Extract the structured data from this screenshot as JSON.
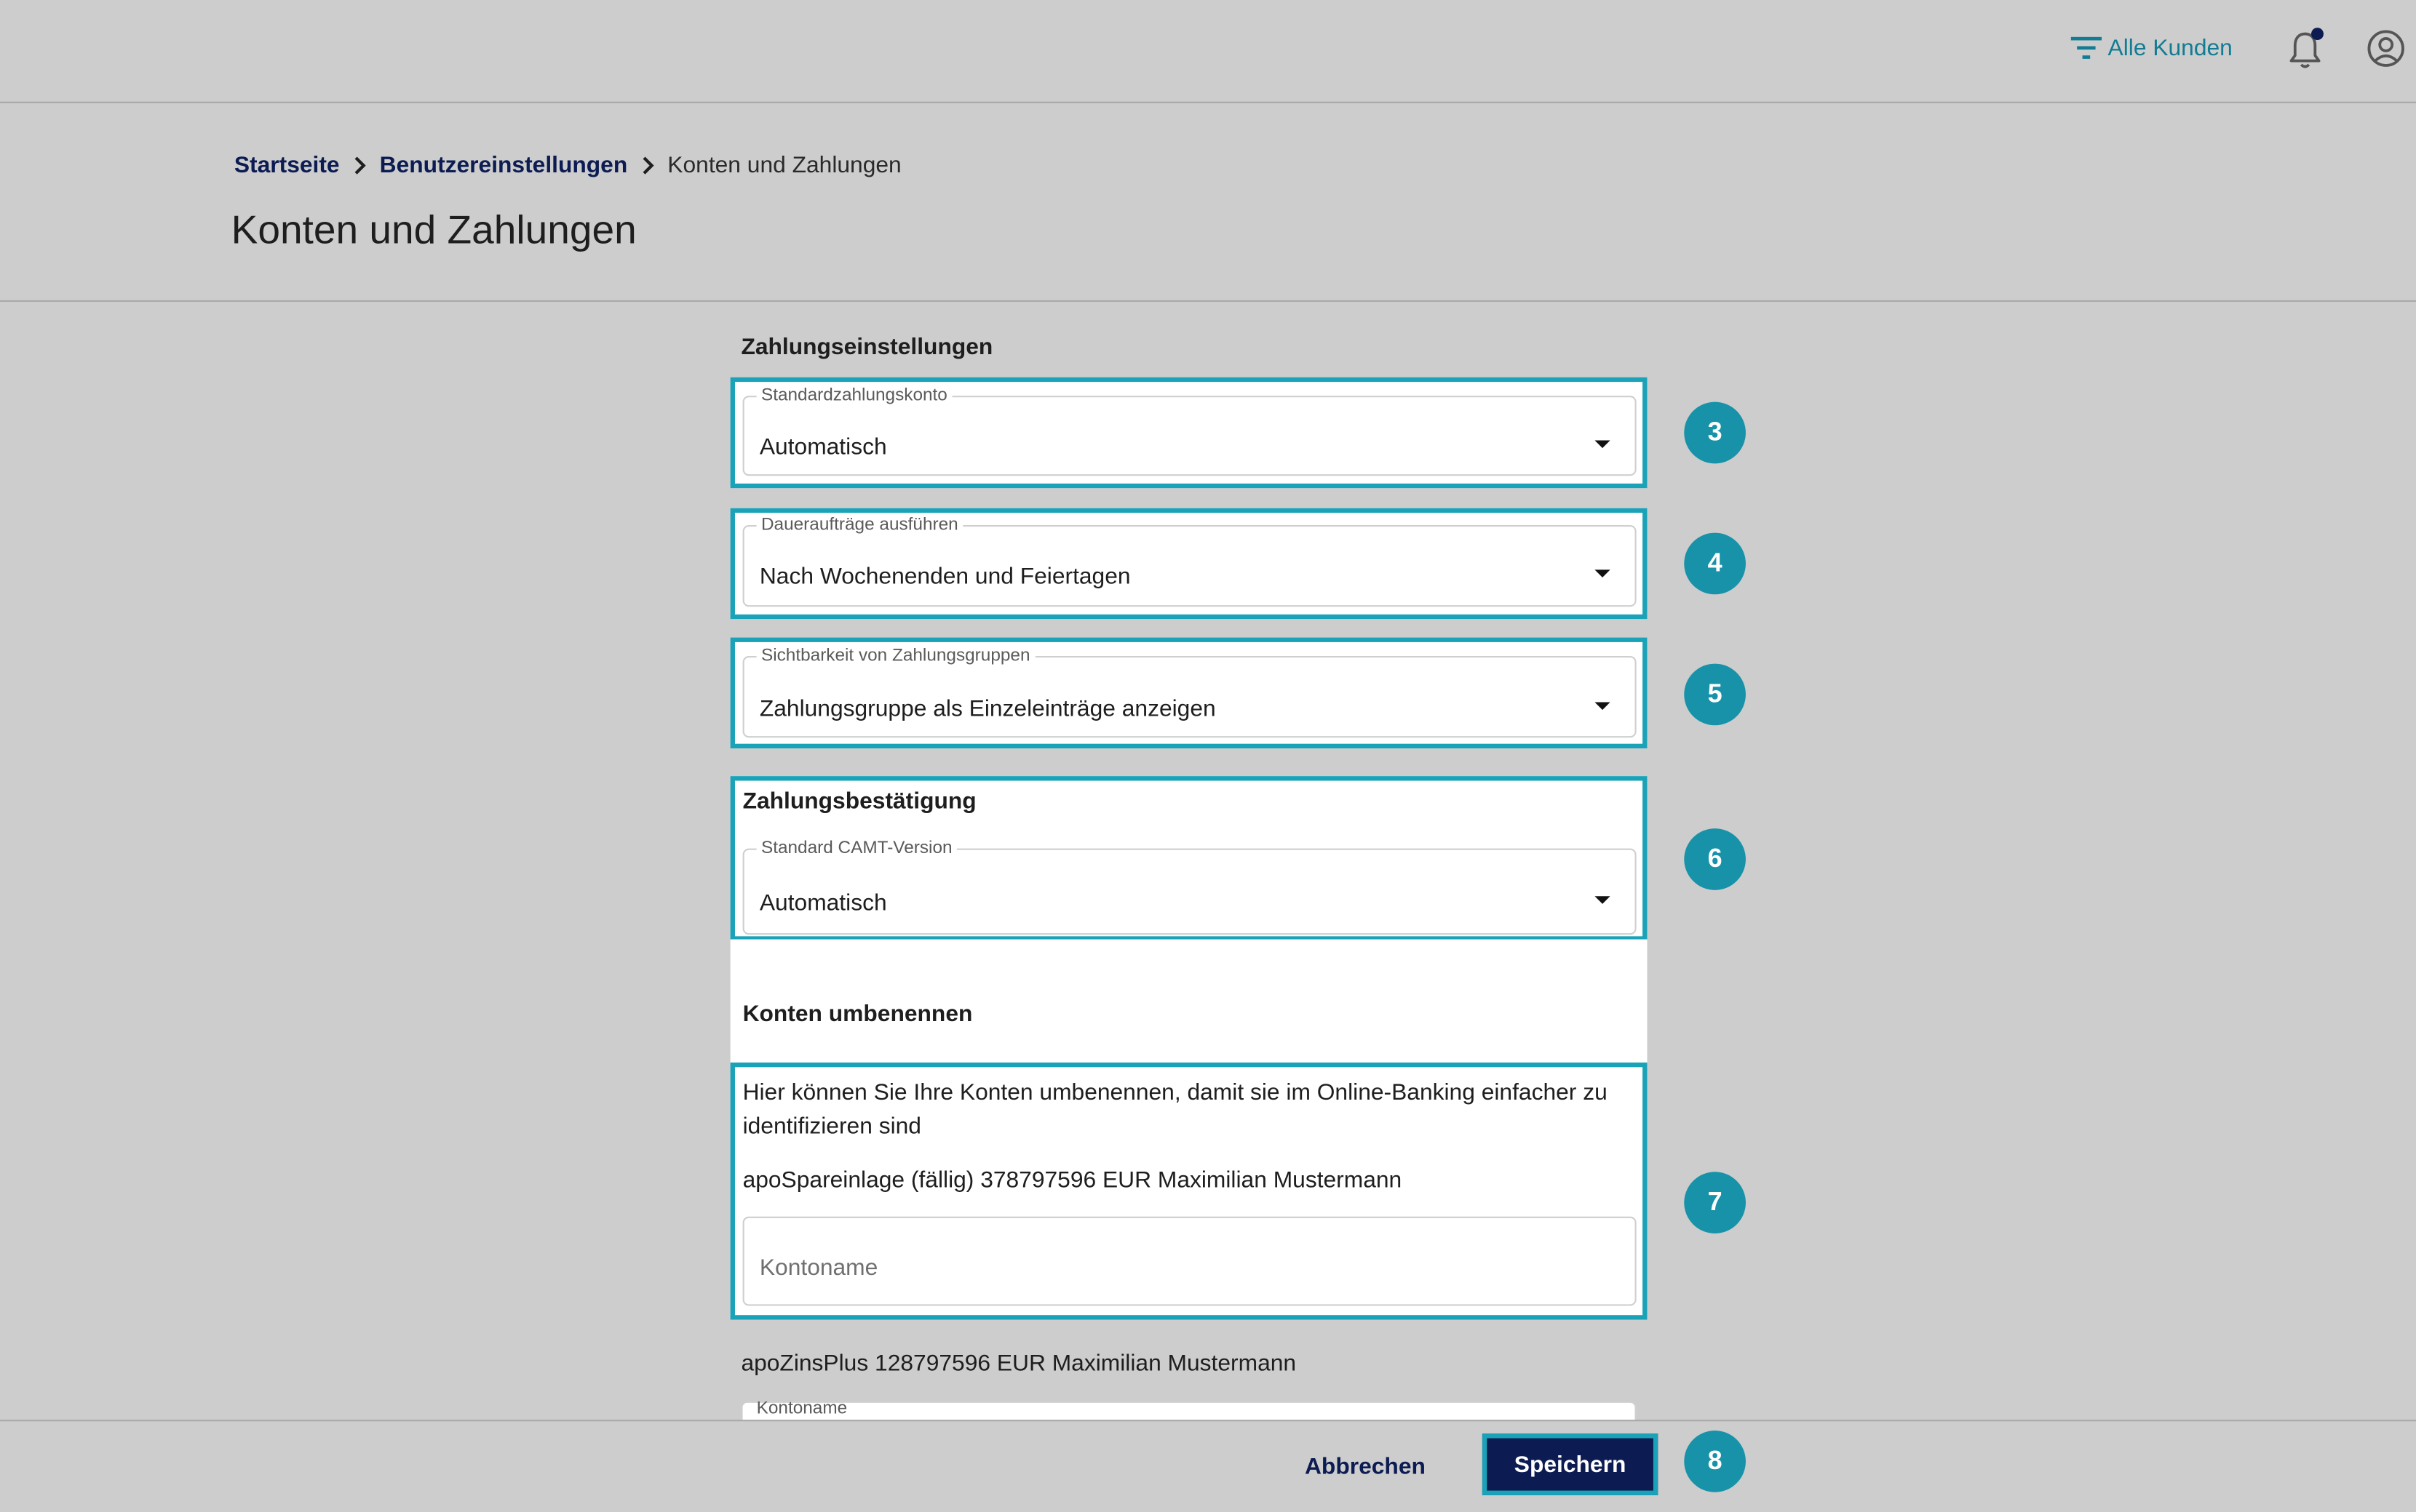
{
  "topbar": {
    "filter_label": "Alle Kunden",
    "filter_icon": "filter-icon",
    "bell_icon": "bell-icon",
    "account_icon": "account-circle-icon"
  },
  "breadcrumb": {
    "items": [
      "Startseite",
      "Benutzereinstellungen",
      "Konten und Zahlungen"
    ]
  },
  "page": {
    "title": "Konten und Zahlungen"
  },
  "payment_settings": {
    "title": "Zahlungseinstellungen",
    "fields": [
      {
        "label": "Standardzahlungskonto",
        "value": "Automatisch"
      },
      {
        "label": "Daueraufträge ausführen",
        "value": "Nach Wochenenden und Feiertagen"
      },
      {
        "label": "Sichtbarkeit von Zahlungsgruppen",
        "value": "Zahlungsgruppe als Einzeleinträge anzeigen"
      }
    ]
  },
  "payment_confirmation": {
    "title": "Zahlungsbestätigung",
    "field": {
      "label": "Standard CAMT-Version",
      "value": "Automatisch"
    }
  },
  "rename_accounts": {
    "title": "Konten umbenennen",
    "description": "Hier können Sie Ihre Konten umbenennen, damit sie im Online-Banking einfacher zu identifizieren sind",
    "accounts": [
      {
        "label": "apoSpareinlage (fällig) 378797596 EUR Maximilian Mustermann",
        "input_placeholder": "Kontoname",
        "input_value": ""
      },
      {
        "label": "apoZinsPlus 128797596 EUR Maximilian Mustermann",
        "input_legend": "Kontoname"
      }
    ]
  },
  "badges": [
    "3",
    "4",
    "5",
    "6",
    "7",
    "8"
  ],
  "footer": {
    "cancel_label": "Abbrechen",
    "save_label": "Speichern"
  },
  "colors": {
    "background": "#cdcdcd",
    "accent_teal": "#1aa3b8",
    "badge_teal": "#1792a9",
    "navy": "#0c1c52",
    "link_teal": "#117c93"
  }
}
